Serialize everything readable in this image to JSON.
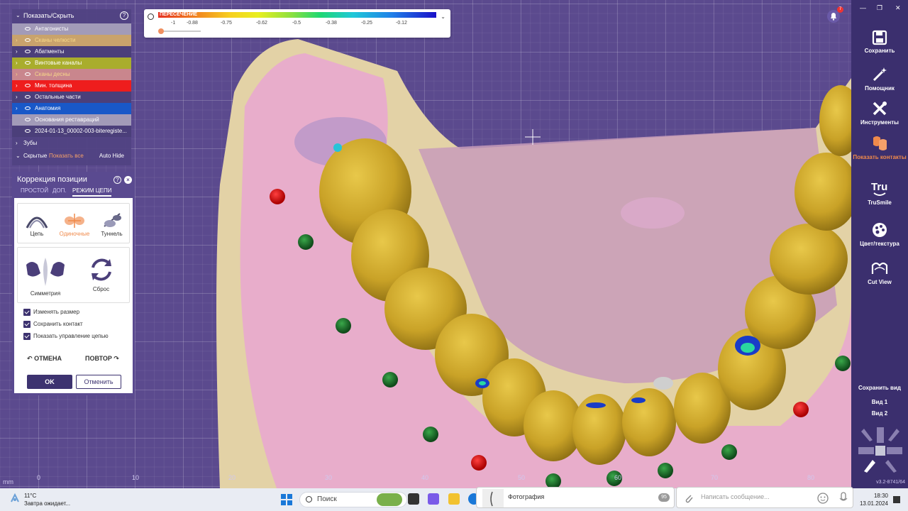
{
  "colorbar": {
    "label": "ПЕРЕСЕЧЕНИЕ",
    "ticks": [
      "-1",
      "-0.88",
      "-0.75",
      "-0.62",
      "-0.5",
      "-0.38",
      "-0.25",
      "-0.12"
    ]
  },
  "layers": {
    "header": "Показать/Скрыть",
    "items": [
      {
        "label": "Антагонисты",
        "color": "#a29bb8"
      },
      {
        "label": "Сканы челюсти",
        "color": "#c9a36c"
      },
      {
        "label": "Абатменты",
        "color": "#4b3f7a"
      },
      {
        "label": "Винтовые каналы",
        "color": "#a9ad2c"
      },
      {
        "label": "Сканы десны",
        "color": "#c9868d"
      },
      {
        "label": "Мин. толщина",
        "color": "#ee1d1d"
      },
      {
        "label": "Остальные части",
        "color": "#4b3f7a"
      },
      {
        "label": "Анатомия",
        "color": "#1958c8"
      },
      {
        "label": "Основания реставраций",
        "color": "#a29bb8"
      },
      {
        "label": "2024-01-13_00002-003-biteregiste...",
        "color": "#4b3f7a"
      }
    ],
    "teeth": "Зубы",
    "hidden": "Скрытые",
    "show_all": "Показать все",
    "auto_hide": "Auto Hide"
  },
  "position_correction": {
    "title": "Коррекция позиции",
    "tabs": [
      "ПРОСТОЙ",
      "ДОП.",
      "РЕЖИМ ЦЕПИ"
    ],
    "tools": [
      "Цепь",
      "Одиночные",
      "Туннель"
    ],
    "symmetry": "Симметрия",
    "reset": "Сброс",
    "checkboxes": [
      "Изменять размер",
      "Сохранить контакт",
      "Показать управление цепью"
    ],
    "undo": "ОТМЕНА",
    "redo": "ПОВТОР",
    "ok": "OK",
    "cancel": "Отменить"
  },
  "right_toolbar": {
    "items": [
      "Сохранить",
      "Помощник",
      "Инструменты",
      "Показать контакты",
      "TruSmile",
      "Цвет/текстура",
      "Cut View"
    ],
    "save_view": "Сохранить вид",
    "view1": "Вид 1",
    "view2": "Вид 2",
    "version": "v3.2-8741/64"
  },
  "notification_count": "7",
  "axis": {
    "unit": "mm",
    "ticks": [
      "0",
      "10",
      "20",
      "30",
      "40",
      "50",
      "60",
      "70",
      "80"
    ]
  },
  "taskbar": {
    "temperature": "11°C",
    "weather_text": "Завтра ожидает...",
    "search": "Поиск",
    "photo_label": "Фотография",
    "photo_count": "95",
    "message_placeholder": "Написать сообщение...",
    "time": "18:30",
    "date": "13.01.2024"
  }
}
